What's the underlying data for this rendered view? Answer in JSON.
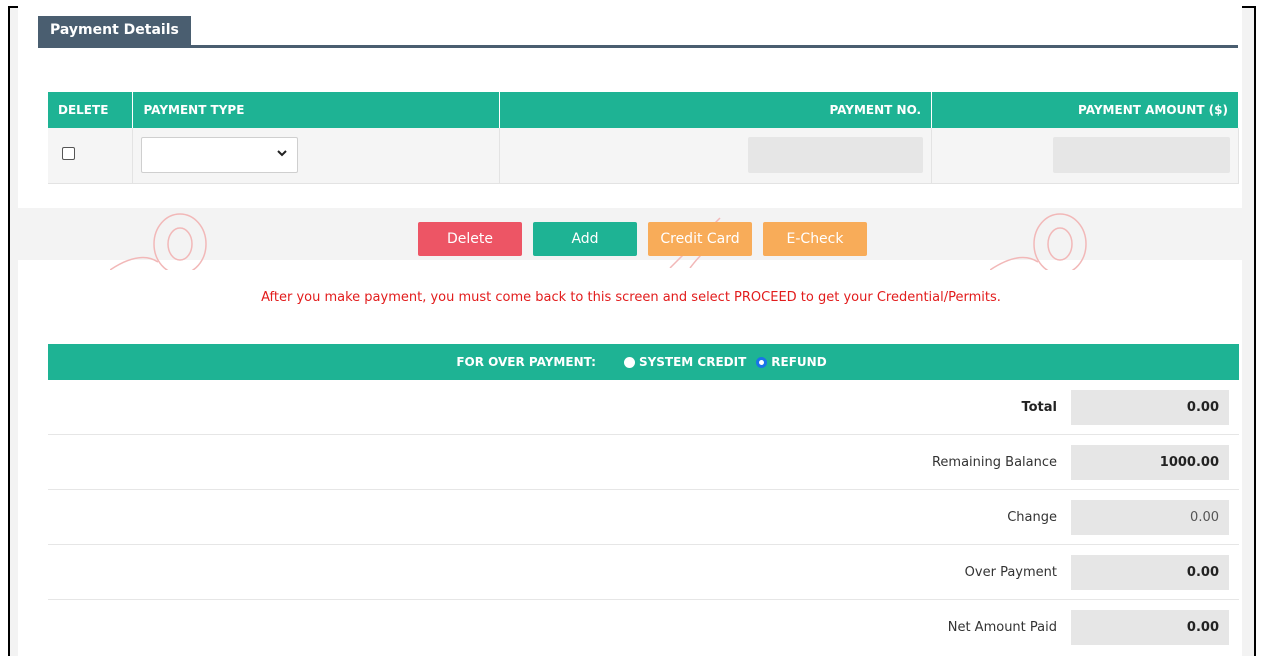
{
  "section": {
    "title": "Payment Details"
  },
  "grid": {
    "columns": {
      "delete": "DELETE",
      "payment_type": "PAYMENT TYPE",
      "payment_no": "PAYMENT NO.",
      "payment_amount": "PAYMENT AMOUNT ($)"
    },
    "row": {
      "payment_type_value": "",
      "payment_no": "",
      "payment_amount": ""
    }
  },
  "buttons": {
    "delete": "Delete",
    "add": "Add",
    "credit_card": "Credit Card",
    "echeck": "E-Check"
  },
  "notice": "After you make payment, you must come back to this screen and select PROCEED to get your Credential/Permits.",
  "over_payment": {
    "label": "FOR OVER PAYMENT:",
    "option_credit": "SYSTEM CREDIT",
    "option_refund": "REFUND",
    "selected": "REFUND"
  },
  "summary": {
    "total_label": "Total",
    "total_value": "0.00",
    "remaining_label": "Remaining Balance",
    "remaining_value": "1000.00",
    "change_label": "Change",
    "change_value": "0.00",
    "over_label": "Over Payment",
    "over_value": "0.00",
    "net_label": "Net Amount Paid",
    "net_value": "0.00"
  },
  "colors": {
    "accent": "#1eb394",
    "danger": "#ed5565",
    "warning": "#f8ac59",
    "header": "#4a5e70",
    "notice": "#e21c1c"
  }
}
